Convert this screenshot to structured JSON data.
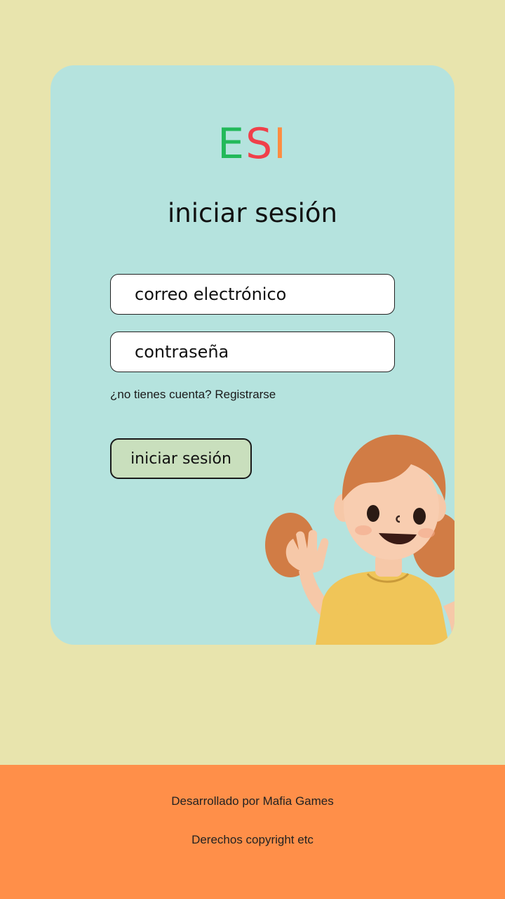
{
  "logo": {
    "letters": [
      "E",
      "S",
      "I"
    ],
    "colors": [
      "#22b95a",
      "#f0404a",
      "#ff8c40"
    ]
  },
  "login_title": "iniciar sesión",
  "email": {
    "placeholder": "correo electrónico",
    "value": ""
  },
  "password": {
    "placeholder": "contraseña",
    "value": ""
  },
  "register": {
    "prompt": "¿no tienes cuenta?",
    "link": "Registrarse"
  },
  "login_button": "iniciar sesión",
  "illustration": "waving-girl-illustration",
  "footer": {
    "developed_by": "Desarrollado por Mafia Games",
    "copyright": "Derechos copyright etc"
  },
  "colors": {
    "page_background": "#e8e4ad",
    "card_background": "#b5e3de",
    "button_background": "#c9dfbd",
    "footer_background": "#ff8f49"
  }
}
